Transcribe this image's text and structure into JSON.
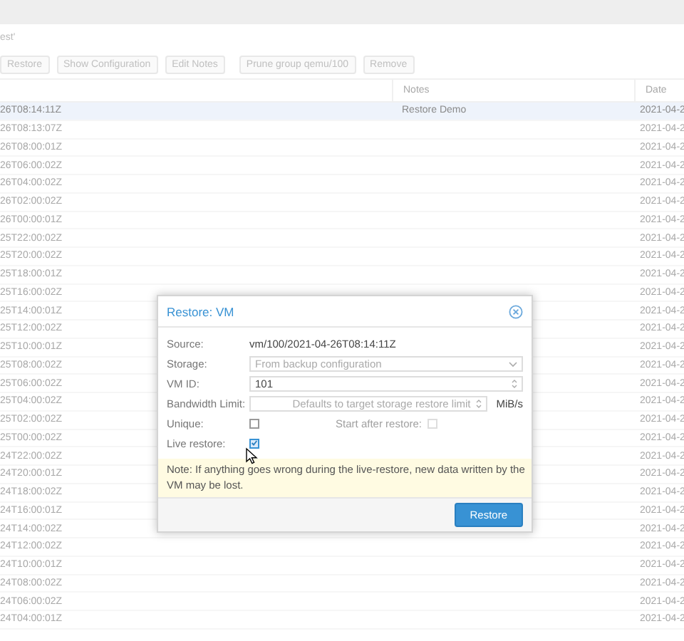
{
  "header": {
    "title": "est'"
  },
  "toolbar": [
    "Restore",
    "Show Configuration",
    "Edit Notes",
    "Prune group qemu/100",
    "Remove"
  ],
  "table": {
    "columns": [
      "Notes",
      "Date"
    ],
    "rows": [
      {
        "name": "26T08:14:11Z",
        "notes": "Restore Demo",
        "date": "2021-04-2",
        "selected": true
      },
      {
        "name": "26T08:13:07Z",
        "notes": "",
        "date": "2021-04-2",
        "selected": false
      },
      {
        "name": "26T08:00:01Z",
        "date": "2021-04-2",
        "selected": false
      },
      {
        "name": "26T06:00:02Z",
        "date": "2021-04-2",
        "selected": false
      },
      {
        "name": "26T04:00:02Z",
        "date": "2021-04-2",
        "selected": false
      },
      {
        "name": "26T02:00:02Z",
        "date": "2021-04-2",
        "selected": false
      },
      {
        "name": "26T00:00:01Z",
        "date": "2021-04-2",
        "selected": false
      },
      {
        "name": "25T22:00:02Z",
        "date": "2021-04-2",
        "selected": false
      },
      {
        "name": "25T20:00:02Z",
        "date": "2021-04-2",
        "selected": false
      },
      {
        "name": "25T18:00:01Z",
        "date": "2021-04-2",
        "selected": false
      },
      {
        "name": "25T16:00:02Z",
        "date": "2021-04-2",
        "selected": false
      },
      {
        "name": "25T14:00:01Z",
        "date": "2021-04-2",
        "selected": false
      },
      {
        "name": "25T12:00:02Z",
        "date": "2021-04-2",
        "selected": false
      },
      {
        "name": "25T10:00:01Z",
        "date": "2021-04-2",
        "selected": false
      },
      {
        "name": "25T08:00:02Z",
        "date": "2021-04-2",
        "selected": false
      },
      {
        "name": "25T06:00:02Z",
        "date": "2021-04-2",
        "selected": false
      },
      {
        "name": "25T04:00:02Z",
        "date": "2021-04-2",
        "selected": false
      },
      {
        "name": "25T02:00:02Z",
        "date": "2021-04-2",
        "selected": false
      },
      {
        "name": "25T00:00:02Z",
        "date": "2021-04-2",
        "selected": false
      },
      {
        "name": "24T22:00:02Z",
        "date": "2021-04-2",
        "selected": false
      },
      {
        "name": "24T20:00:01Z",
        "date": "2021-04-2",
        "selected": false
      },
      {
        "name": "24T18:00:02Z",
        "date": "2021-04-2",
        "selected": false
      },
      {
        "name": "24T16:00:01Z",
        "date": "2021-04-2",
        "selected": false
      },
      {
        "name": "24T14:00:02Z",
        "date": "2021-04-2",
        "selected": false
      },
      {
        "name": "24T12:00:02Z",
        "date": "2021-04-2",
        "selected": false
      },
      {
        "name": "24T10:00:01Z",
        "date": "2021-04-2",
        "selected": false
      },
      {
        "name": "24T08:00:02Z",
        "date": "2021-04-2",
        "selected": false
      },
      {
        "name": "24T06:00:02Z",
        "date": "2021-04-2",
        "selected": false
      },
      {
        "name": "24T04:00:01Z",
        "date": "2021-04-2",
        "selected": false
      }
    ]
  },
  "dialog": {
    "title": "Restore: VM",
    "source": {
      "label": "Source:",
      "value": "vm/100/2021-04-26T08:14:11Z"
    },
    "storage": {
      "label": "Storage:",
      "placeholder": "From backup configuration"
    },
    "vmid": {
      "label": "VM ID:",
      "value": "101"
    },
    "bandwidth": {
      "label": "Bandwidth Limit:",
      "placeholder": "Defaults to target storage restore limit",
      "unit": "MiB/s"
    },
    "unique": {
      "label": "Unique:",
      "checked": false
    },
    "start_after": {
      "label": "Start after restore:",
      "checked": false,
      "disabled": true
    },
    "live_restore": {
      "label": "Live restore:",
      "checked": true
    },
    "note": "Note: If anything goes wrong during the live-restore, new data written by the VM may be lost.",
    "button": "Restore"
  }
}
